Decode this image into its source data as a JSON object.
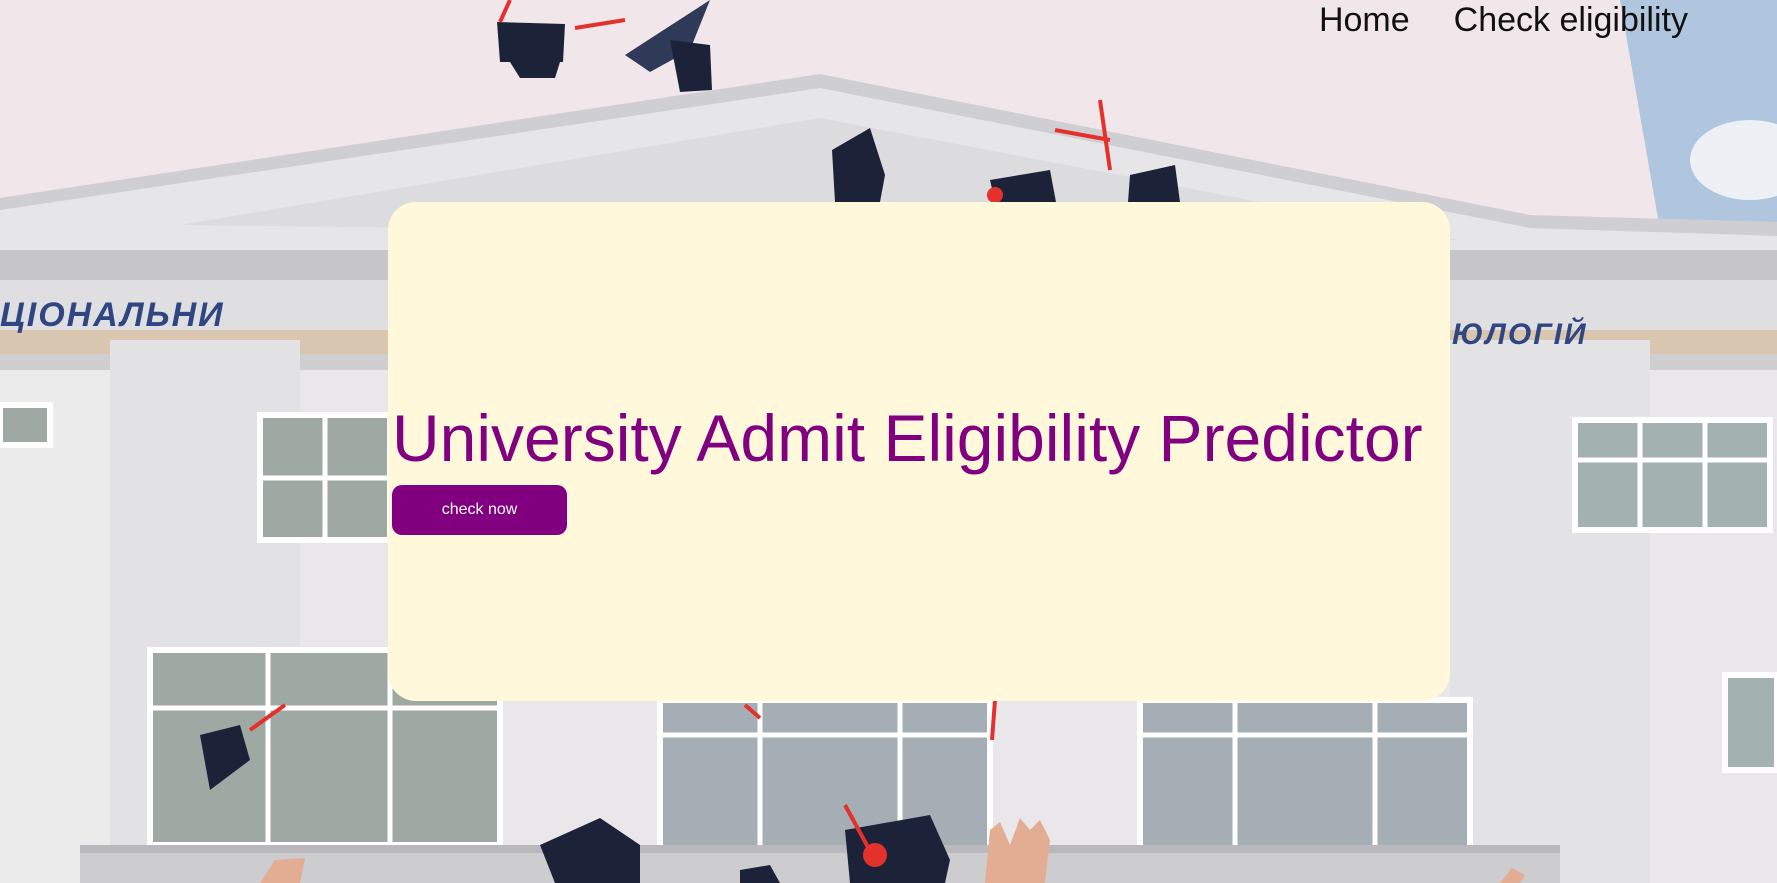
{
  "nav": {
    "items": [
      {
        "label": "Home"
      },
      {
        "label": "Check eligibility"
      }
    ]
  },
  "hero": {
    "title": "University Admit Eligibility Predictor",
    "button_label": "check now"
  },
  "colors": {
    "accent": "#800080",
    "card_background": "#fff8da",
    "nav_text": "#111111"
  },
  "background": {
    "image_subject": "graduation-caps-thrown-in-front-of-university-building",
    "facade_sign_left": "ЦІОНАЛЬНИ",
    "facade_sign_right": "ЮЛОГІЙ"
  }
}
